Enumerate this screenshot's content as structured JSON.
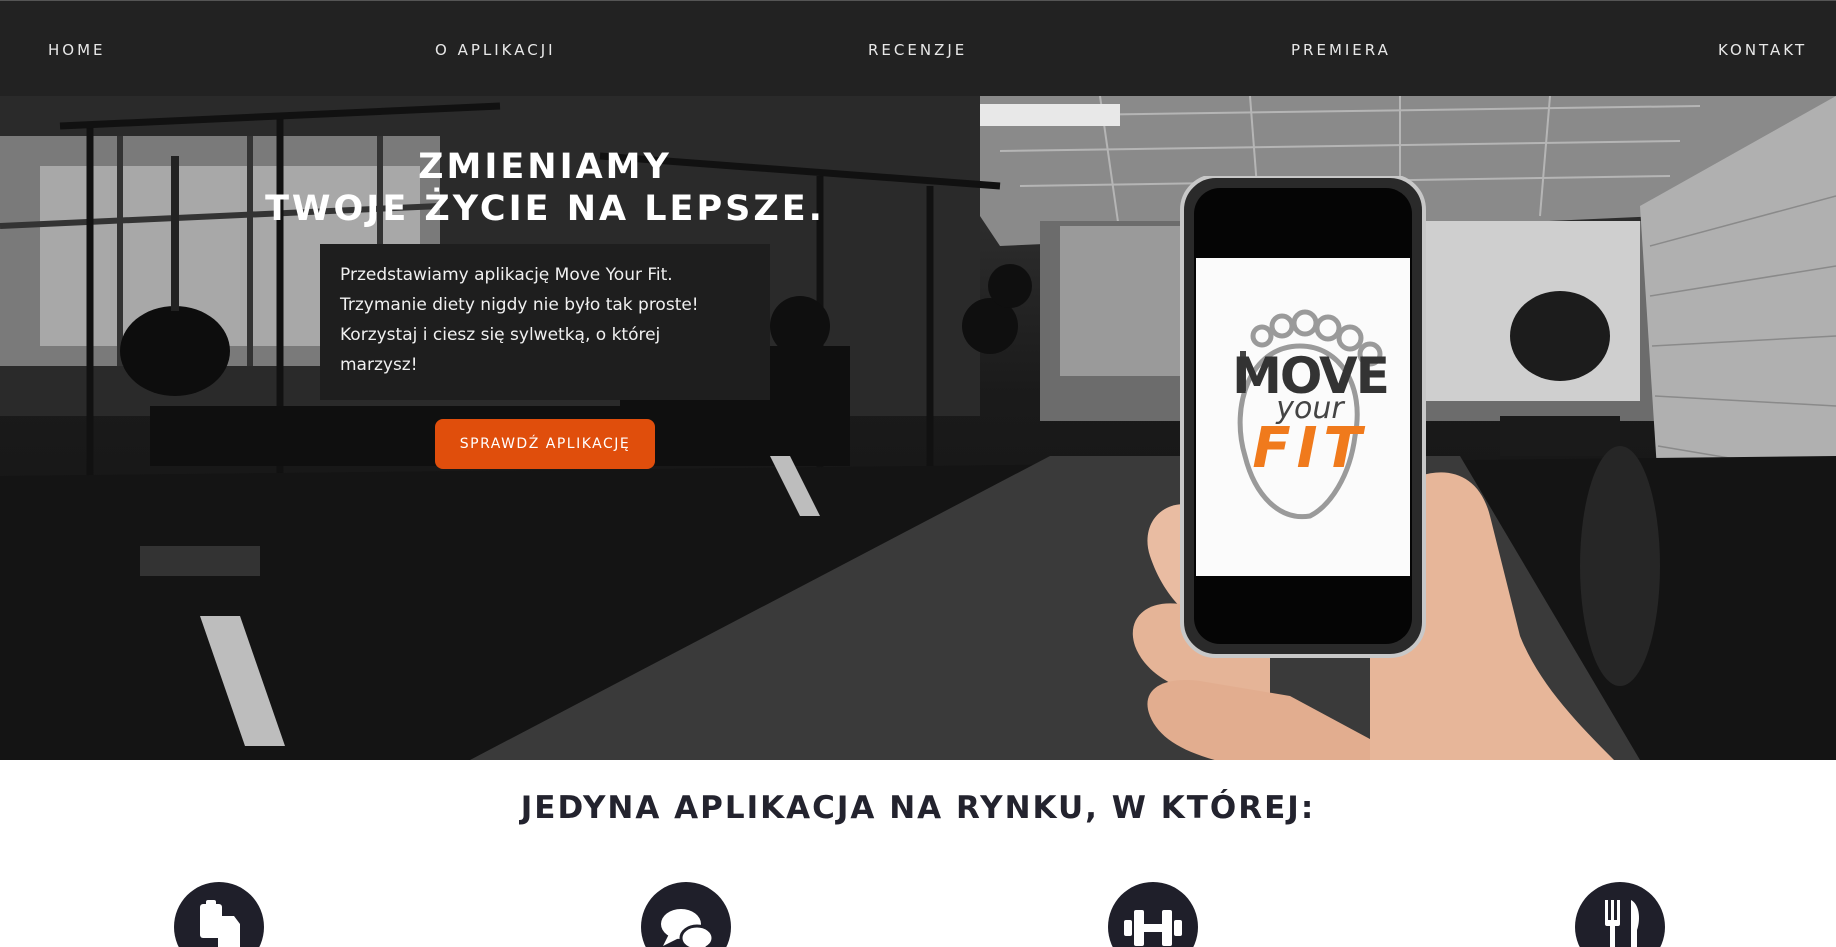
{
  "nav": {
    "items": [
      {
        "label": "HOME"
      },
      {
        "label": "O APLIKACJI"
      },
      {
        "label": "RECENZJE"
      },
      {
        "label": "PREMIERA"
      },
      {
        "label": "KONTAKT"
      }
    ]
  },
  "hero": {
    "title_line1": "ZMIENIAMY",
    "title_line2": "TWOJE ŻYCIE NA LEPSZE.",
    "description_lines": [
      "Przedstawiamy aplikację Move Your Fit.",
      "Trzymanie diety nigdy nie było tak proste!",
      "Korzystaj i ciesz się sylwetką, o której",
      "marzysz!"
    ],
    "cta_label": "SPRAWDŹ APLIKACJĘ"
  },
  "app_logo": {
    "line1": "MOVE",
    "line2": "your",
    "line3": "FIT"
  },
  "features": {
    "title": "JEDYNA APLIKACJA NA RYNKU, W KTÓREJ:",
    "icons": [
      "documents-icon",
      "chat-bubbles-icon",
      "dumbbell-icon",
      "fork-knife-icon"
    ]
  },
  "colors": {
    "accent": "#e04e0c",
    "nav_bg": "#222222",
    "dark_text": "#23232e",
    "logo_orange": "#f07a1c"
  }
}
